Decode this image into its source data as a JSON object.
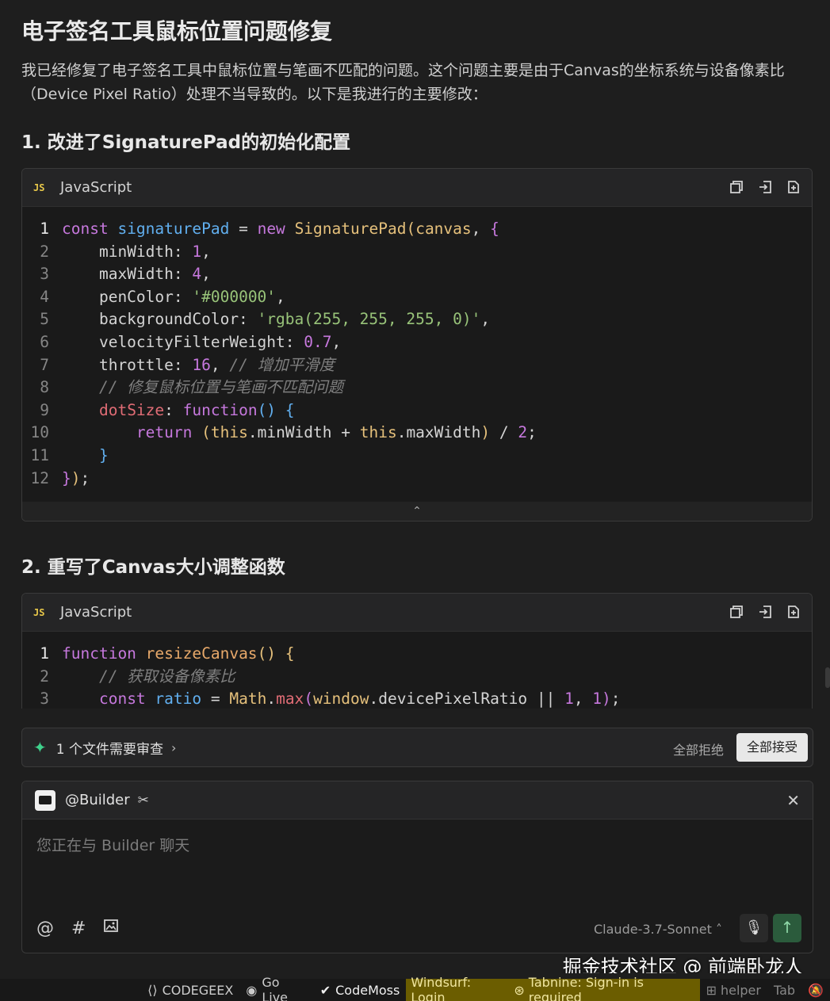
{
  "heading": "电子签名工具鼠标位置问题修复",
  "intro": "我已经修复了电子签名工具中鼠标位置与笔画不匹配的问题。这个问题主要是由于Canvas的坐标系统与设备像素比（Device Pixel Ratio）处理不当导致的。以下是我进行的主要修改：",
  "section1": {
    "title": "1. 改进了SignaturePad的初始化配置",
    "badge": "JS",
    "lang": "JavaScript",
    "lines": [
      {
        "n": "1",
        "active": true
      },
      {
        "n": "2"
      },
      {
        "n": "3"
      },
      {
        "n": "4"
      },
      {
        "n": "5"
      },
      {
        "n": "6"
      },
      {
        "n": "7"
      },
      {
        "n": "8"
      },
      {
        "n": "9"
      },
      {
        "n": "10"
      },
      {
        "n": "11"
      },
      {
        "n": "12"
      }
    ],
    "collapse": "⌃"
  },
  "section2": {
    "title": "2. 重写了Canvas大小调整函数",
    "badge": "JS",
    "lang": "JavaScript",
    "lines": [
      {
        "n": "1",
        "active": true
      },
      {
        "n": "2"
      },
      {
        "n": "3"
      }
    ]
  },
  "review": {
    "text": "1 个文件需要审查",
    "reject": "全部拒绝",
    "accept": "全部接受"
  },
  "input": {
    "agent": "@Builder",
    "placeholder": "您正在与 Builder 聊天",
    "model": "Claude-3.7-Sonnet"
  },
  "watermark": "掘金技术社区 @ 前端卧龙人",
  "statusbar": {
    "codegeex": "CODEGEEX",
    "golive": "Go Live",
    "codemoss": "CodeMoss",
    "windsurf": "Windsurf: Login",
    "tabnine": "Tabnine: Sign-in is required",
    "helper": "helper",
    "tab": "Tab"
  },
  "icons": [
    "copy-icon",
    "insert-icon",
    "apply-icon",
    "sparkle-icon",
    "chevron-right-icon",
    "close-icon",
    "at-icon",
    "hash-icon",
    "image-icon",
    "mic-icon",
    "send-icon",
    "bell-off-icon"
  ]
}
